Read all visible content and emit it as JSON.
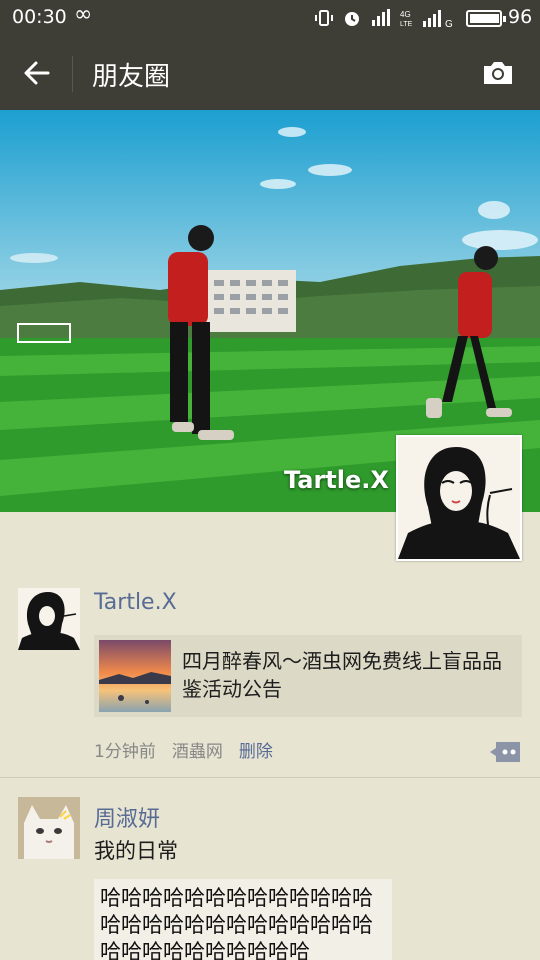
{
  "status_bar": {
    "time": "00:30",
    "battery": "96"
  },
  "nav": {
    "title": "朋友圈"
  },
  "cover": {
    "name": "Tartle.X"
  },
  "posts": [
    {
      "username": "Tartle.X",
      "link_title": "四月醉春风～酒虫网免费线上盲品品鉴活动公告",
      "time": "1分钟前",
      "source": "酒蟲网",
      "delete": "删除"
    },
    {
      "username": "周淑妍",
      "text": "我的日常",
      "image_text": "哈哈哈哈哈哈哈哈哈哈哈哈哈哈哈哈哈哈哈哈哈哈哈哈哈哈哈哈哈哈哈哈哈哈哈哈"
    }
  ],
  "icons": {
    "back": "arrow-left-icon",
    "camera": "camera-icon",
    "comment": "comment-icon"
  },
  "colors": {
    "nav_bg": "#3e3d36",
    "page_bg": "#e7e4d1",
    "link_blue": "#576b95"
  }
}
